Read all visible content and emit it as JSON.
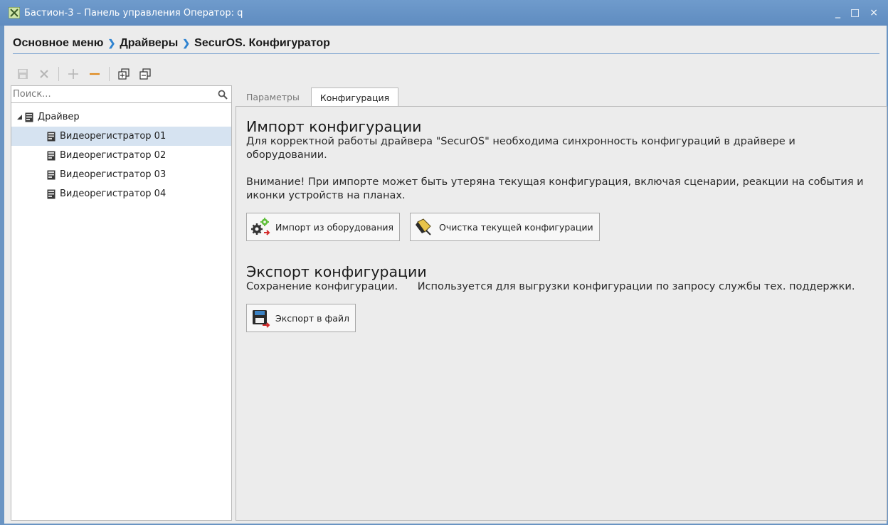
{
  "window": {
    "title": "Бастион-3 – Панель управления Оператор: q",
    "minimize": "_",
    "maximize": "□",
    "close": "×"
  },
  "breadcrumb": {
    "items": [
      "Основное меню",
      "Драйверы",
      "SecurOS. Конфигуратор"
    ],
    "separator": "❯"
  },
  "search": {
    "placeholder": "Поиск..."
  },
  "tree": {
    "root": "Драйвер",
    "children": [
      "Видеорегистратор 01",
      "Видеорегистратор 02",
      "Видеорегистратор 03",
      "Видеорегистратор 04"
    ],
    "selected_index": 0
  },
  "tabs": [
    {
      "label": "Параметры",
      "active": false
    },
    {
      "label": "Конфигурация",
      "active": true
    }
  ],
  "import": {
    "title": "Импорт конфигурации",
    "text1": "Для корректной работы драйвера \"SecurOS\" необходима синхронность конфигураций в драйвере и оборудовании.",
    "text2": "Внимание! При импорте может быть утеряна текущая конфигурация, включая сценарии, реакции на события и иконки устройств на планах.",
    "btn_import": "Импорт из оборудования",
    "btn_clear": "Очистка текущей конфигурации"
  },
  "export": {
    "title": "Экспорт конфигурации",
    "text": "Сохранение конфигурации.      Используется для выгрузки конфигурации по запросу службы тех. поддержки.",
    "btn_export": "Экспорт в файл"
  },
  "colors": {
    "titlebar": "#6f9bcc",
    "accent_orange": "#e08a1e",
    "breadcrumb_sep": "#2f83d0",
    "selection": "#d6e3f1"
  },
  "icons": {
    "toolbar": [
      "save-icon",
      "delete-icon",
      "add-icon",
      "remove-icon",
      "expand-all-icon",
      "collapse-all-icon"
    ]
  }
}
